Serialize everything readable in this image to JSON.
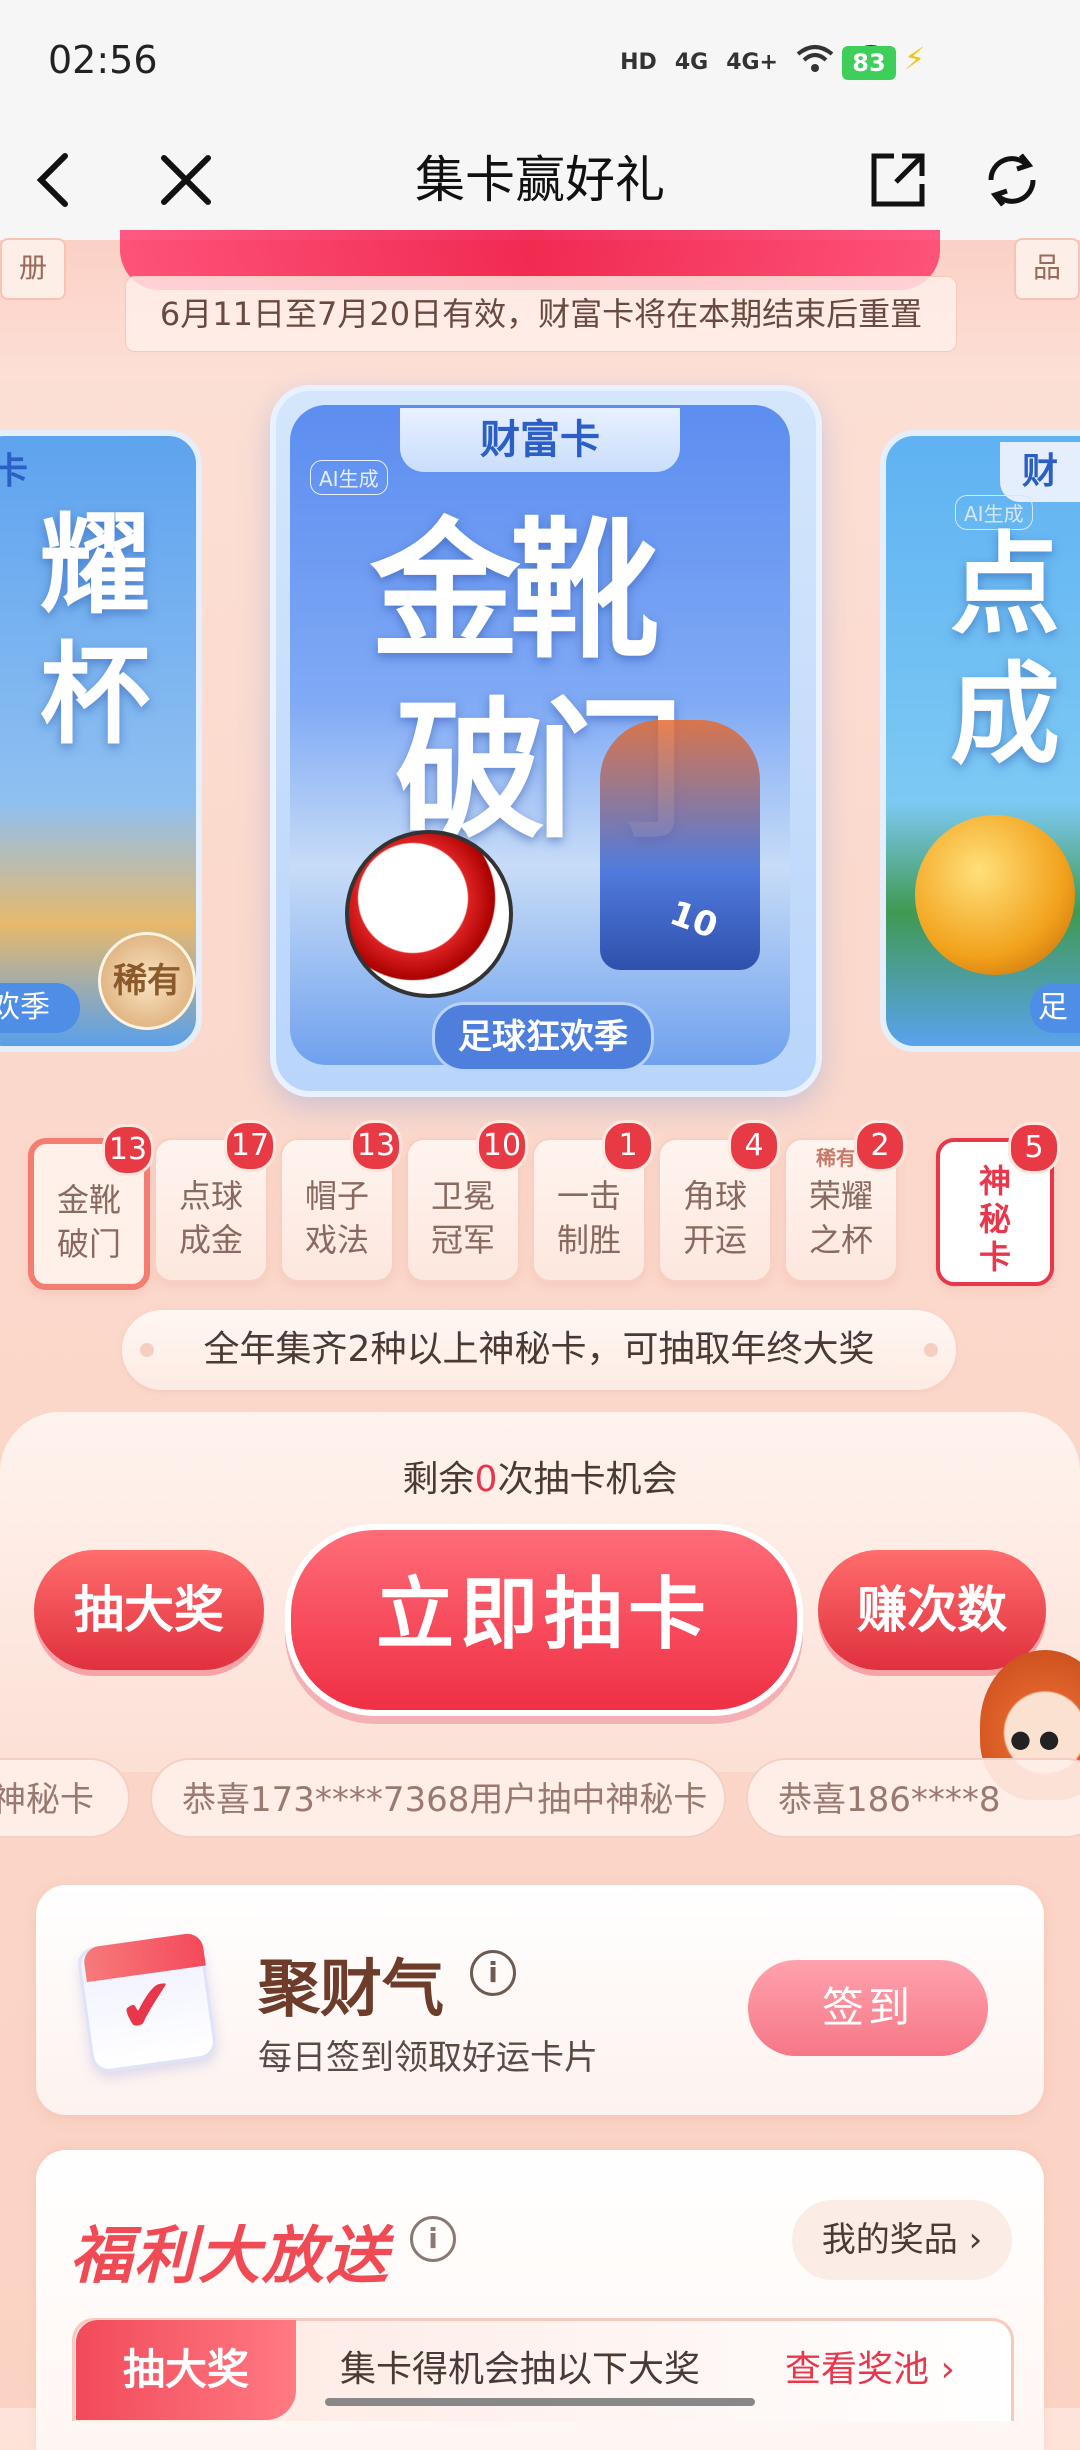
{
  "status_bar": {
    "time": "02:56",
    "icons": [
      "HD",
      "4G",
      "4G+",
      "wifi-icon",
      "wifi-icon"
    ],
    "battery": "83"
  },
  "nav": {
    "title": "集卡赢好礼",
    "back_icon": "back-icon",
    "close_icon": "close-icon",
    "share_icon": "share-icon",
    "refresh_icon": "refresh-icon"
  },
  "hero": {
    "left_tag": "册",
    "right_tag": "品",
    "validity": "6月11日至7月20日有效，财富卡将在本期结束后重置"
  },
  "cards": {
    "center": {
      "type": "财富卡",
      "ai_label": "AI生成",
      "title_line1": "金靴",
      "title_line2": "破门",
      "jersey": "10",
      "footer": "足球狂欢季"
    },
    "left": {
      "type": "卡",
      "title": "耀\n杯",
      "rare_badge": "稀有",
      "footer": "欢季"
    },
    "right": {
      "type": "财",
      "ai_label": "AI生成",
      "title": "点\n成",
      "footer": "足"
    }
  },
  "chips": [
    {
      "label": "金靴\n破门",
      "count": "13",
      "active": true
    },
    {
      "label": "点球\n成金",
      "count": "17"
    },
    {
      "label": "帽子\n戏法",
      "count": "13"
    },
    {
      "label": "卫冕\n冠军",
      "count": "10"
    },
    {
      "label": "一击\n制胜",
      "count": "1"
    },
    {
      "label": "角球\n开运",
      "count": "4"
    },
    {
      "label": "荣耀\n之杯",
      "count": "2",
      "rare": "稀有"
    },
    {
      "label": "神\n秘\n卡",
      "count": "5",
      "mystery": true
    }
  ],
  "notice": "全年集齐2种以上神秘卡，可抽取年终大奖",
  "draw": {
    "remaining_prefix": "剩余",
    "remaining_count": "0",
    "remaining_suffix": "次抽卡机会",
    "draw_big_prize": "抽大奖",
    "draw_now": "立即抽卡",
    "earn_times": "赚次数"
  },
  "ticker": [
    "神秘卡",
    "恭喜173****7368用户抽中神秘卡",
    "恭喜186****8"
  ],
  "checkin": {
    "title": "聚财气",
    "subtitle": "每日签到领取好运卡片",
    "button": "签到"
  },
  "welfare": {
    "title": "福利大放送",
    "my_prizes": "我的奖品 ›",
    "tag": "抽大奖",
    "desc": "集卡得机会抽以下大奖",
    "view_pool": "查看奖池 ›"
  },
  "colors": {
    "accent_red": "#e8374b",
    "card_blue": "#5c8df0",
    "background_peach": "#fbd9cc"
  }
}
